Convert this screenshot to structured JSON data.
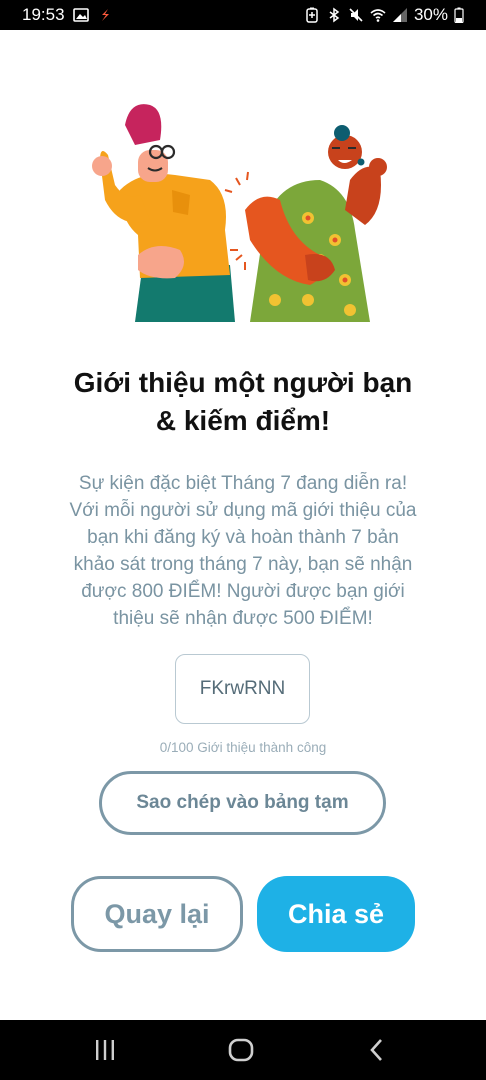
{
  "status_bar": {
    "time": "19:53",
    "battery": "30%",
    "icons_left": [
      "image-icon",
      "app-notification-icon"
    ],
    "icons_right": [
      "battery-saver-icon",
      "bluetooth-icon",
      "mute-icon",
      "wifi-icon",
      "signal-icon",
      "battery-icon"
    ]
  },
  "illustration": {
    "icon": "two-friends-thumbs-up-illustration"
  },
  "title": {
    "line1": "Giới thiệu một người bạn",
    "line2": "& kiếm điểm!"
  },
  "description": {
    "lines": [
      "Sự kiện đặc biệt Tháng 7 đang diễn ra!",
      "Với mỗi người sử dụng mã giới thiệu của",
      "bạn khi đăng ký và hoàn thành 7 bản",
      "khảo sát trong tháng 7 này, bạn sẽ nhận",
      "được 800 ĐIỂM! Người được bạn giới",
      "thiệu sẽ nhận được 500 ĐIỂM!"
    ]
  },
  "referral": {
    "code": "FKrwRNN",
    "success_text": "0/100 Giới thiệu thành công"
  },
  "buttons": {
    "copy": "Sao chép vào bảng tạm",
    "back": "Quay lại",
    "share": "Chia sẻ"
  },
  "colors": {
    "accent": "#1eb1e6",
    "secondary": "#7c98a7"
  }
}
